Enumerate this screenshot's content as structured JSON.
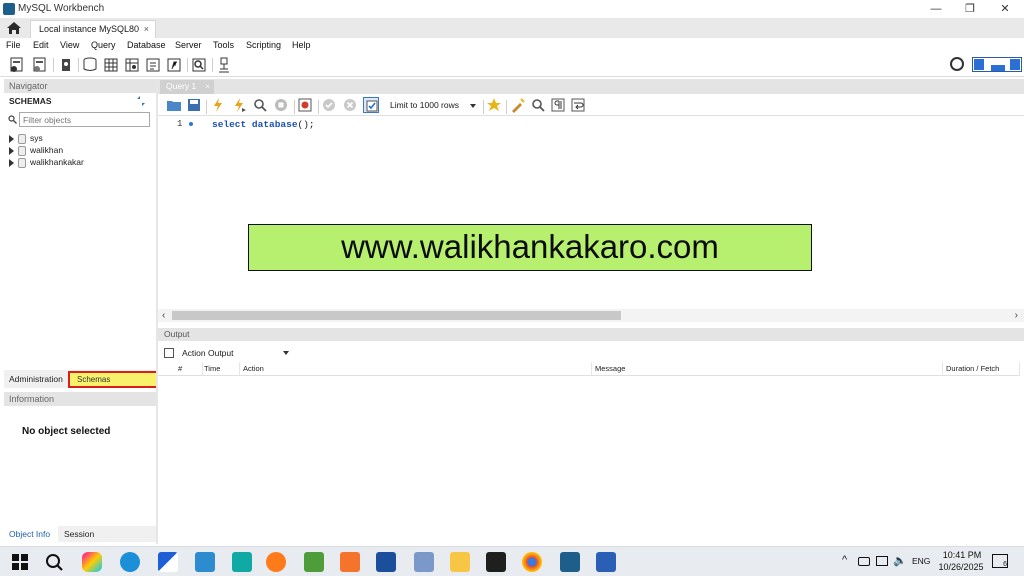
{
  "window": {
    "title": "MySQL Workbench"
  },
  "tabs": {
    "connection": "Local instance MySQL80",
    "close": "×"
  },
  "menu": [
    "File",
    "Edit",
    "View",
    "Query",
    "Database",
    "Server",
    "Tools",
    "Scripting",
    "Help"
  ],
  "navigator": {
    "header": "Navigator",
    "schemas_title": "SCHEMAS",
    "filter_placeholder": "Filter objects",
    "schemas": [
      "sys",
      "walikhan",
      "walikhankakar"
    ],
    "tabs": {
      "administration": "Administration",
      "schemas": "Schemas"
    }
  },
  "information": {
    "header": "Information",
    "empty": "No object selected",
    "tabs": {
      "object_info": "Object Info",
      "session": "Session"
    }
  },
  "query": {
    "tab_label": "Query 1",
    "tab_close": "×",
    "limit": "Limit to 1000 rows",
    "line_number": "1",
    "code_keyword": "select",
    "code_function": "database",
    "code_rest": "();"
  },
  "banner": "www.walikhankakaro.com",
  "output": {
    "header": "Output",
    "selector": "Action Output",
    "columns": [
      "#",
      "Time",
      "Action",
      "Message",
      "Duration / Fetch"
    ]
  },
  "taskbar": {
    "lang": "ENG",
    "time": "10:41 PM",
    "date": "10/26/2025",
    "notification_count": "6"
  },
  "colors": {
    "banner_bg": "#b7f06e",
    "highlight_tab": "#f7f26a",
    "highlight_border": "#d91e1e"
  }
}
